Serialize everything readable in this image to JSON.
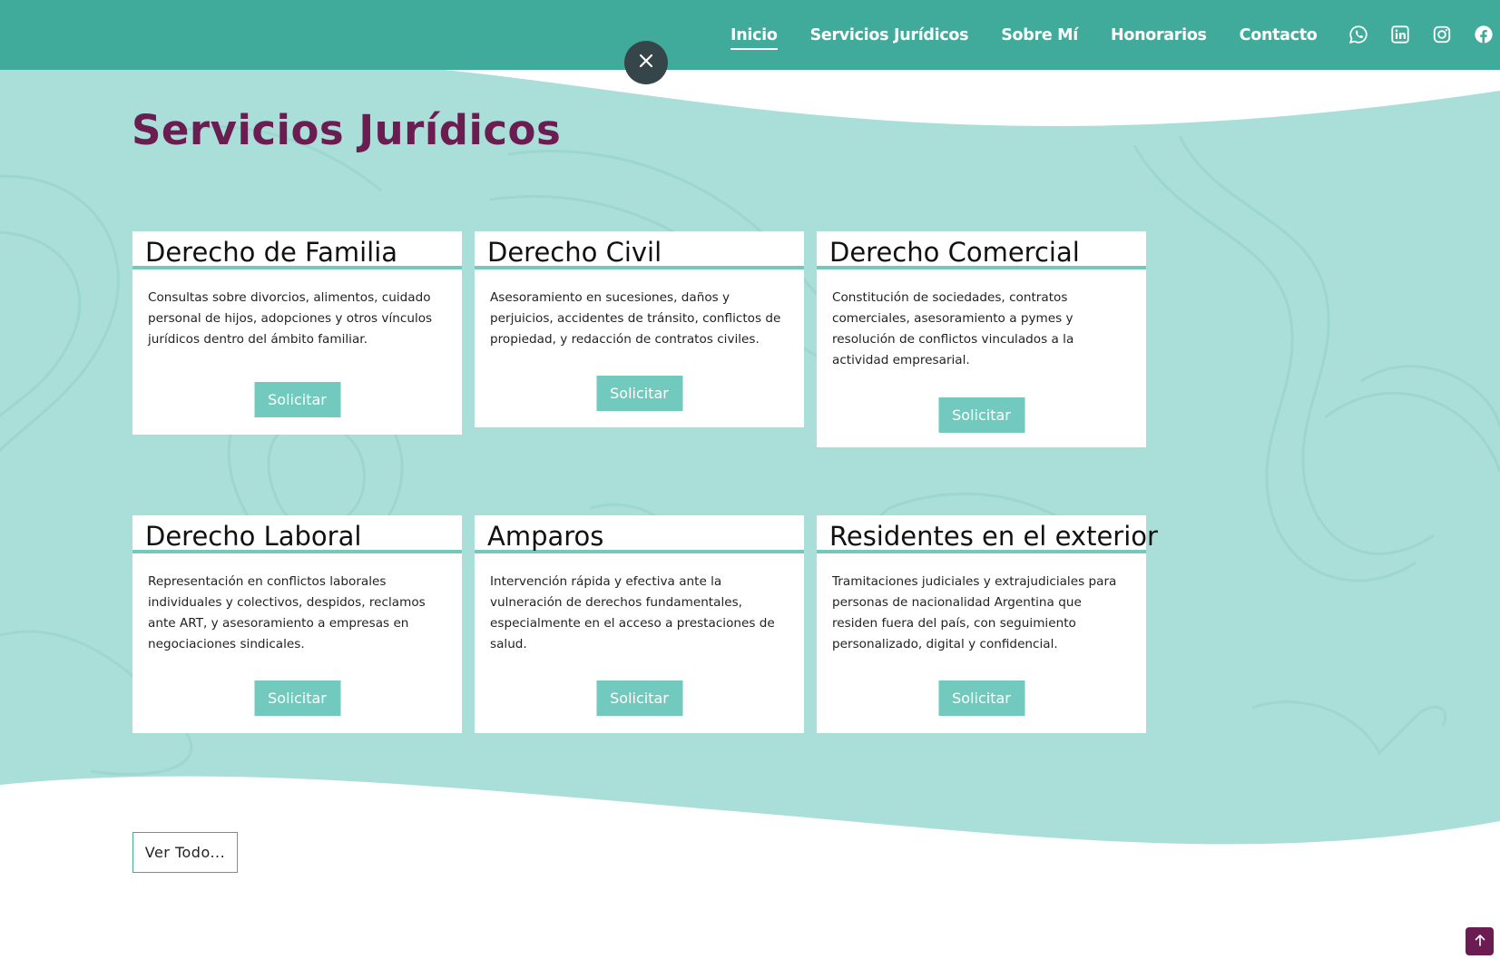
{
  "nav": {
    "items": [
      {
        "label": "Inicio",
        "active": true
      },
      {
        "label": "Servicios Jurídicos",
        "active": false
      },
      {
        "label": "Sobre Mí",
        "active": false
      },
      {
        "label": "Honorarios",
        "active": false
      },
      {
        "label": "Contacto",
        "active": false
      }
    ],
    "social": [
      "whatsapp-icon",
      "linkedin-icon",
      "instagram-icon",
      "facebook-icon"
    ]
  },
  "colors": {
    "header": "#41ab9b",
    "section_bg": "#a9dfd8",
    "accent": "#72c9bd",
    "title": "#6b1d52",
    "close_button": "#36454a"
  },
  "section": {
    "title": "Servicios Jurídicos"
  },
  "cards": [
    {
      "title": "Derecho de Familia",
      "text": "Consultas sobre divorcios, alimentos, cuidado personal de hijos, adopciones y otros vínculos jurídicos dentro del ámbito familiar.",
      "button": "Solicitar"
    },
    {
      "title": "Derecho Civil",
      "text": "Asesoramiento en sucesiones, daños y perjuicios, accidentes de tránsito, conflictos de propiedad, y redacción de contratos civiles.",
      "button": "Solicitar"
    },
    {
      "title": "Derecho Comercial",
      "text": "Constitución de sociedades, contratos comerciales, asesoramiento a pymes y resolución de conflictos vinculados a la actividad empresarial.",
      "button": "Solicitar"
    },
    {
      "title": "Derecho Laboral",
      "text": "Representación en conflictos laborales individuales y colectivos, despidos, reclamos ante ART, y asesoramiento a empresas en negociaciones sindicales.",
      "button": "Solicitar"
    },
    {
      "title": "Amparos",
      "text": "Intervención rápida y efectiva ante la vulneración de derechos fundamentales, especialmente en el acceso a prestaciones de salud.",
      "button": "Solicitar"
    },
    {
      "title": "Residentes en el exterior",
      "text": "Tramitaciones judiciales y extrajudiciales para personas de nacionalidad Argentina que residen fuera del país, con seguimiento personalizado, digital y confidencial.",
      "button": "Solicitar"
    }
  ],
  "ver_todo": "Ver Todo...",
  "icons": {
    "close": "close-icon",
    "scroll_top": "arrow-up-icon"
  }
}
